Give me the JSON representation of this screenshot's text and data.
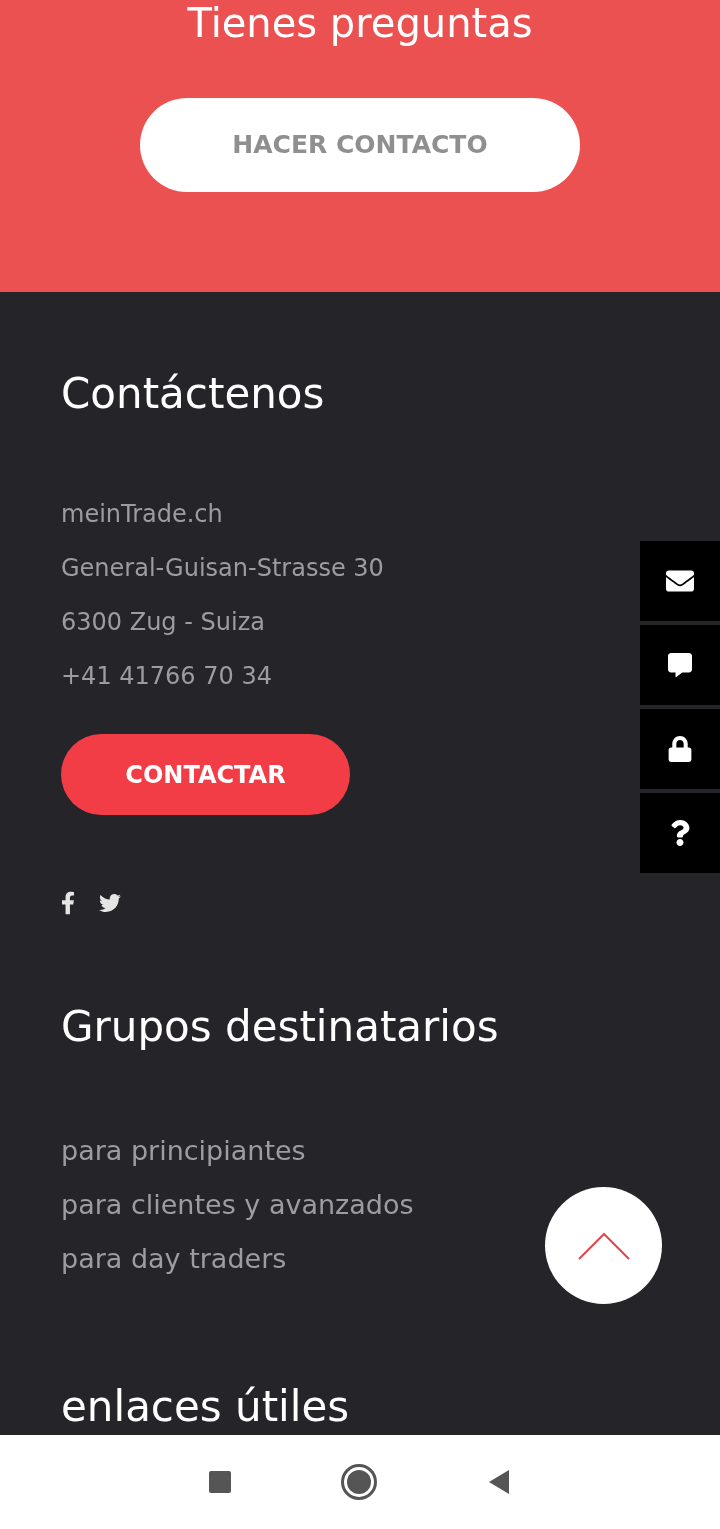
{
  "banner": {
    "title": "Tienes preguntas",
    "button": "HACER CONTACTO"
  },
  "contact": {
    "title": "Contáctenos",
    "lines": [
      "meinTrade.ch",
      "General-Guisan-Strasse 30",
      "6300 Zug - Suiza",
      "+41 41766 70 34"
    ],
    "button": "CONTACTAR",
    "social": [
      {
        "kind": "facebook"
      },
      {
        "kind": "twitter"
      }
    ]
  },
  "groups": {
    "title": "Grupos destinatarios",
    "links": [
      "para principiantes",
      "para clientes y avanzados",
      "para day traders"
    ]
  },
  "links_section": {
    "title": "enlaces útiles"
  },
  "side_buttons": [
    {
      "kind": "mail"
    },
    {
      "kind": "chat"
    },
    {
      "kind": "lock"
    },
    {
      "kind": "help"
    }
  ],
  "nav_bar": [
    {
      "kind": "recents"
    },
    {
      "kind": "home"
    },
    {
      "kind": "back"
    }
  ]
}
